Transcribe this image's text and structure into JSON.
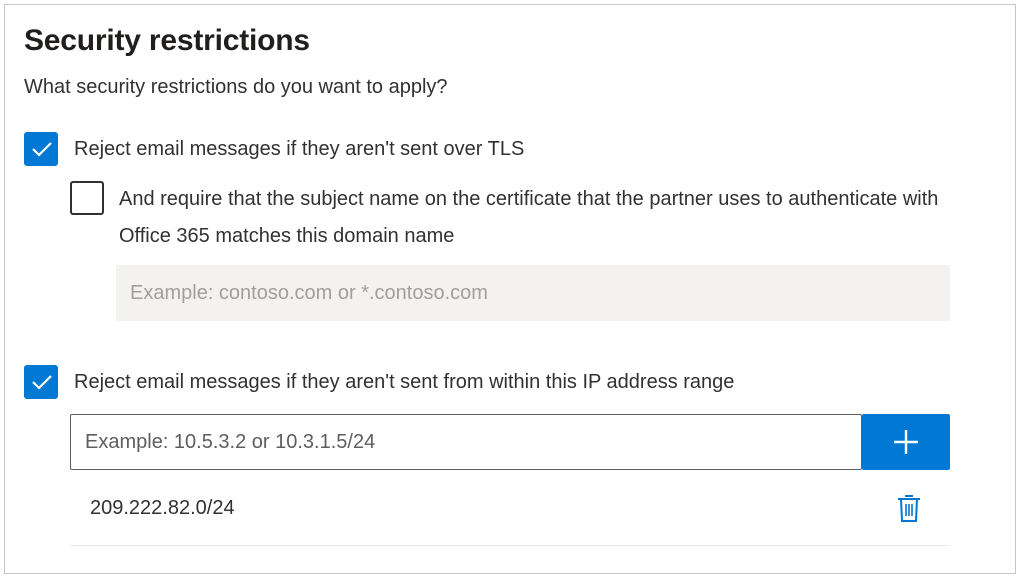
{
  "section": {
    "title": "Security restrictions",
    "subtitle": "What security restrictions do you want to apply?"
  },
  "tls": {
    "checked": true,
    "label": "Reject email messages if they aren't sent over TLS"
  },
  "certificate": {
    "checked": false,
    "label": "And require that the subject name on the certificate that the partner uses to authenticate with Office 365 matches this domain name",
    "domain_value": "",
    "domain_placeholder": "Example: contoso.com or *.contoso.com"
  },
  "ip_restriction": {
    "checked": true,
    "label": "Reject email messages if they aren't sent from within this IP address range",
    "input_value": "",
    "input_placeholder": "Example: 10.5.3.2 or 10.3.1.5/24",
    "add_icon": "plus-icon",
    "delete_icon": "trash-icon",
    "ranges": [
      "209.222.82.0/24"
    ]
  },
  "colors": {
    "accent": "#0078d4",
    "text": "#323130",
    "disabled_bg": "#f3f2f1",
    "border": "#c8c6c4"
  }
}
